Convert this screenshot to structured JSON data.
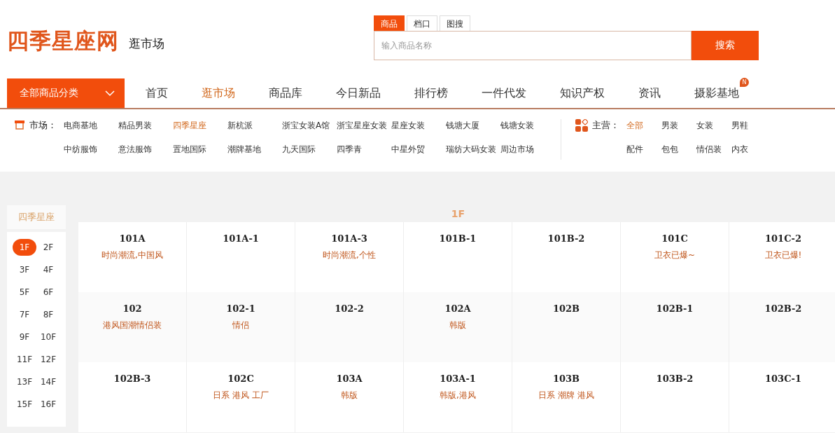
{
  "logo": {
    "name": "四季星座网",
    "subtitle": "逛市场"
  },
  "search": {
    "tabs": [
      {
        "label": "商品",
        "selected": true
      },
      {
        "label": "档口",
        "selected": false
      },
      {
        "label": "图搜",
        "selected": false
      }
    ],
    "placeholder": "输入商品名称",
    "button": "搜索"
  },
  "nav": {
    "category_button": "全部商品分类",
    "items": [
      {
        "label": "首页",
        "selected": false
      },
      {
        "label": "逛市场",
        "selected": true
      },
      {
        "label": "商品库",
        "selected": false
      },
      {
        "label": "今日新品",
        "selected": false
      },
      {
        "label": "排行榜",
        "selected": false
      },
      {
        "label": "一件代发",
        "selected": false
      },
      {
        "label": "知识产权",
        "selected": false
      },
      {
        "label": "资讯",
        "selected": false
      },
      {
        "label": "摄影基地",
        "selected": false,
        "badge": "N"
      }
    ]
  },
  "markets": {
    "label": "市场：",
    "items": [
      {
        "label": "电商基地",
        "selected": false
      },
      {
        "label": "精品男装",
        "selected": false
      },
      {
        "label": "四季星座",
        "selected": true
      },
      {
        "label": "新杭派",
        "selected": false
      },
      {
        "label": "浙宝女装A馆",
        "selected": false
      },
      {
        "label": "浙宝星座女装",
        "selected": false
      },
      {
        "label": "星座女装",
        "selected": false
      },
      {
        "label": "钱塘大厦",
        "selected": false
      },
      {
        "label": "钱塘女装",
        "selected": false
      },
      {
        "label": "中纺服饰",
        "selected": false
      },
      {
        "label": "意法服饰",
        "selected": false
      },
      {
        "label": "置地国际",
        "selected": false
      },
      {
        "label": "潮牌基地",
        "selected": false
      },
      {
        "label": "九天国际",
        "selected": false
      },
      {
        "label": "四季青",
        "selected": false
      },
      {
        "label": "中星外贸",
        "selected": false
      },
      {
        "label": "瑞纺大码女装",
        "selected": false
      },
      {
        "label": "周边市场",
        "selected": false
      }
    ]
  },
  "categories": {
    "label": "主营：",
    "items": [
      {
        "label": "全部",
        "selected": true
      },
      {
        "label": "男装",
        "selected": false
      },
      {
        "label": "女装",
        "selected": false
      },
      {
        "label": "男鞋",
        "selected": false
      },
      {
        "label": "配件",
        "selected": false
      },
      {
        "label": "包包",
        "selected": false
      },
      {
        "label": "情侣装",
        "selected": false
      },
      {
        "label": "内衣",
        "selected": false
      }
    ]
  },
  "floors": {
    "title": "四季星座",
    "items": [
      {
        "label": "1F",
        "selected": true
      },
      {
        "label": "2F",
        "selected": false
      },
      {
        "label": "3F",
        "selected": false
      },
      {
        "label": "4F",
        "selected": false
      },
      {
        "label": "5F",
        "selected": false
      },
      {
        "label": "6F",
        "selected": false
      },
      {
        "label": "7F",
        "selected": false
      },
      {
        "label": "8F",
        "selected": false
      },
      {
        "label": "9F",
        "selected": false
      },
      {
        "label": "10F",
        "selected": false
      },
      {
        "label": "11F",
        "selected": false
      },
      {
        "label": "12F",
        "selected": false
      },
      {
        "label": "13F",
        "selected": false
      },
      {
        "label": "14F",
        "selected": false
      },
      {
        "label": "15F",
        "selected": false
      },
      {
        "label": "16F",
        "selected": false
      }
    ]
  },
  "stalls": {
    "floor": "1F",
    "items": [
      {
        "code": "101A",
        "tag": "时尚潮流,中国风"
      },
      {
        "code": "101A-1"
      },
      {
        "code": "101A-3",
        "tag": "时尚潮流,个性"
      },
      {
        "code": "101B-1"
      },
      {
        "code": "101B-2"
      },
      {
        "code": "101C",
        "tag": "卫衣已爆~"
      },
      {
        "code": "101C-2",
        "tag": "卫衣已爆!"
      },
      {
        "code": "102",
        "tag": "港风国潮情侣装"
      },
      {
        "code": "102-1",
        "tag": "情侣"
      },
      {
        "code": "102-2"
      },
      {
        "code": "102A",
        "tag": "韩版"
      },
      {
        "code": "102B"
      },
      {
        "code": "102B-1"
      },
      {
        "code": "102B-2"
      },
      {
        "code": "102B-3"
      },
      {
        "code": "102C",
        "tag": "日系 港风 工厂"
      },
      {
        "code": "103A",
        "tag": "韩版"
      },
      {
        "code": "103A-1",
        "tag": "韩版,港风"
      },
      {
        "code": "103B",
        "tag": "日系 潮牌 港风"
      },
      {
        "code": "103B-2"
      },
      {
        "code": "103C-1"
      }
    ]
  }
}
